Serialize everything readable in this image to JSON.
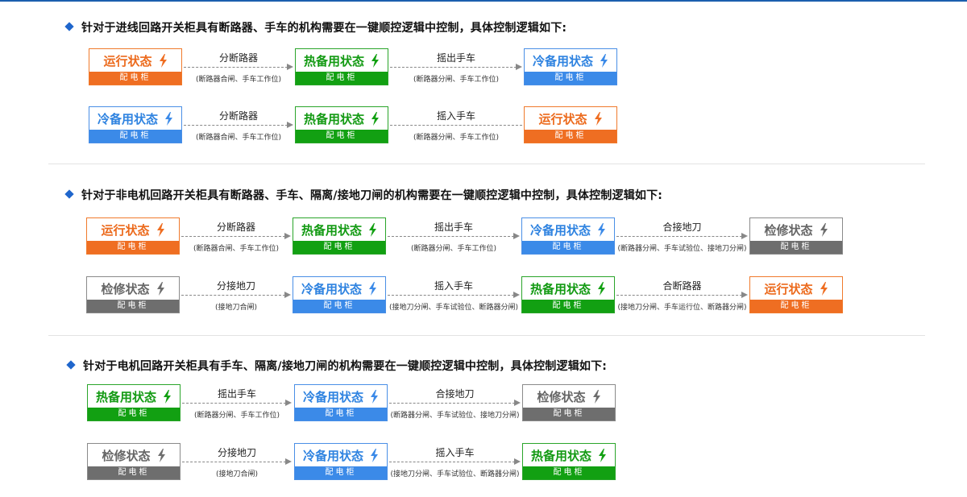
{
  "colors": {
    "orange": "#ef6e22",
    "green": "#12a012",
    "blue": "#3b8ae8",
    "gray": "#6e6e6e",
    "accent": "#1f66cc"
  },
  "sections": [
    {
      "heading": "针对于进线回路开关柜具有断路器、手车的机构需要在一键顺控逻辑中控制，具体控制逻辑如下:",
      "rows": [
        {
          "boxes": [
            {
              "label": "运行状态",
              "footer": "配电柜",
              "color": "orange",
              "icon": "lightning-icon"
            },
            {
              "label": "热备用状态",
              "footer": "配电柜",
              "color": "green",
              "icon": "lightning-icon"
            },
            {
              "label": "冷备用状态",
              "footer": "配电柜",
              "color": "blue",
              "icon": "lightning-icon"
            }
          ],
          "arrows": [
            {
              "label": "分断路器",
              "note": "(断路器合闸、手车工作位)"
            },
            {
              "label": "摇出手车",
              "note": "(断路器分闸、手车工作位)"
            }
          ]
        },
        {
          "boxes": [
            {
              "label": "冷备用状态",
              "footer": "配电柜",
              "color": "blue",
              "icon": "lightning-icon"
            },
            {
              "label": "热备用状态",
              "footer": "配电柜",
              "color": "green",
              "icon": "lightning-icon"
            },
            {
              "label": "运行状态",
              "footer": "配电柜",
              "color": "orange",
              "icon": "lightning-icon"
            }
          ],
          "arrows": [
            {
              "label": "分断路器",
              "note": "(断路器合闸、手车工作位)"
            },
            {
              "label": "摇入手车",
              "note": "(断路器分闸、手车工作位)"
            }
          ]
        }
      ]
    },
    {
      "heading": "针对于非电机回路开关柜具有断路器、手车、隔离/接地刀闸的机构需要在一键顺控逻辑中控制，具体控制逻辑如下:",
      "rows": [
        {
          "boxes": [
            {
              "label": "运行状态",
              "footer": "配电柜",
              "color": "orange",
              "icon": "lightning-icon"
            },
            {
              "label": "热备用状态",
              "footer": "配电柜",
              "color": "green",
              "icon": "lightning-icon"
            },
            {
              "label": "冷备用状态",
              "footer": "配电柜",
              "color": "blue",
              "icon": "lightning-icon"
            },
            {
              "label": "检修状态",
              "footer": "配电柜",
              "color": "gray",
              "icon": "lightning-icon"
            }
          ],
          "arrows": [
            {
              "label": "分断路器",
              "note": "(断路器合闸、手车工作位)"
            },
            {
              "label": "摇出手车",
              "note": "(断路器分闸、手车工作位)"
            },
            {
              "label": "合接地刀",
              "note": "(断路器分闸、手车试验位、接地刀分闸)"
            }
          ]
        },
        {
          "boxes": [
            {
              "label": "检修状态",
              "footer": "配电柜",
              "color": "gray",
              "icon": "lightning-icon"
            },
            {
              "label": "冷备用状态",
              "footer": "配电柜",
              "color": "blue",
              "icon": "lightning-icon"
            },
            {
              "label": "热备用状态",
              "footer": "配电柜",
              "color": "green",
              "icon": "lightning-icon"
            },
            {
              "label": "运行状态",
              "footer": "配电柜",
              "color": "orange",
              "icon": "lightning-icon"
            }
          ],
          "arrows": [
            {
              "label": "分接地刀",
              "note": "(接地刀合闸)"
            },
            {
              "label": "摇入手车",
              "note": "(接地刀分闸、手车试验位、断路器分闸)"
            },
            {
              "label": "合断路器",
              "note": "(接地刀分闸、手车运行位、断路器分闸)"
            }
          ]
        }
      ]
    },
    {
      "heading": "针对于电机回路开关柜具有手车、隔离/接地刀闸的机构需要在一键顺控逻辑中控制，具体控制逻辑如下:",
      "rows": [
        {
          "boxes": [
            {
              "label": "热备用状态",
              "footer": "配电柜",
              "color": "green",
              "icon": "lightning-icon"
            },
            {
              "label": "冷备用状态",
              "footer": "配电柜",
              "color": "blue",
              "icon": "lightning-icon"
            },
            {
              "label": "检修状态",
              "footer": "配电柜",
              "color": "gray",
              "icon": "lightning-icon"
            }
          ],
          "arrows": [
            {
              "label": "摇出手车",
              "note": "(断路器分闸、手车工作位)"
            },
            {
              "label": "合接地刀",
              "note": "(断路器分闸、手车试验位、接地刀分闸)"
            }
          ]
        },
        {
          "boxes": [
            {
              "label": "检修状态",
              "footer": "配电柜",
              "color": "gray",
              "icon": "lightning-icon"
            },
            {
              "label": "冷备用状态",
              "footer": "配电柜",
              "color": "blue",
              "icon": "lightning-icon"
            },
            {
              "label": "热备用状态",
              "footer": "配电柜",
              "color": "green",
              "icon": "lightning-icon"
            }
          ],
          "arrows": [
            {
              "label": "分接地刀",
              "note": "(接地刀合闸)"
            },
            {
              "label": "摇入手车",
              "note": "(接地刀分闸、手车试验位、断路器分闸)"
            }
          ]
        }
      ]
    }
  ]
}
